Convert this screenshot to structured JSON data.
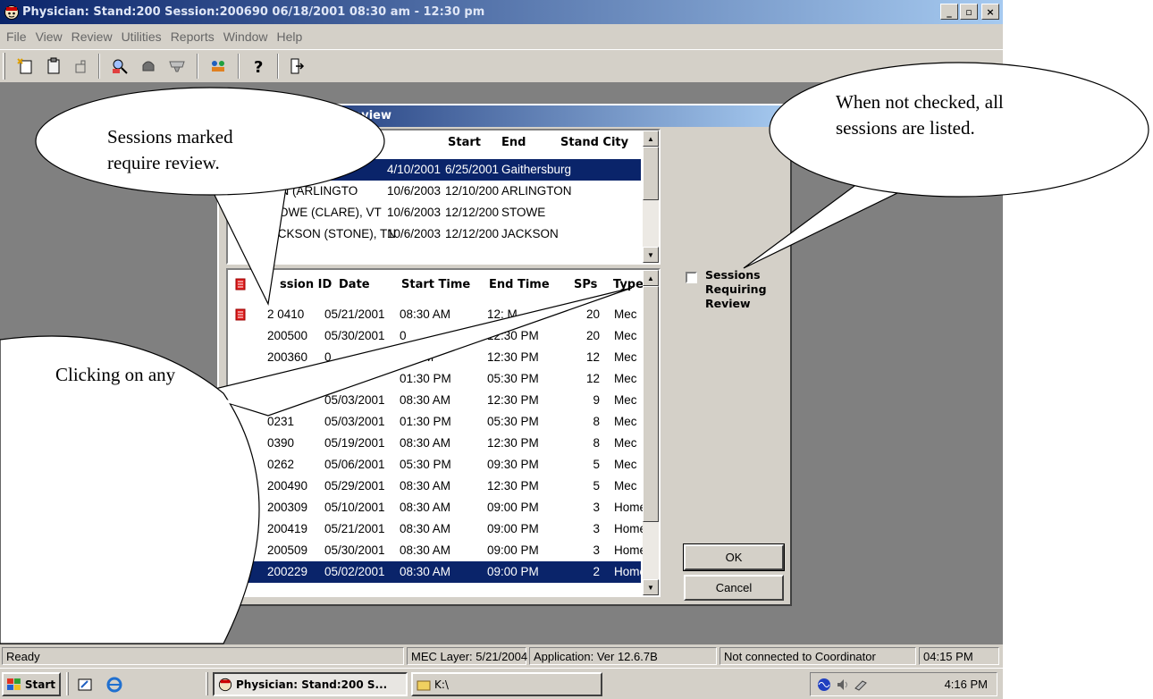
{
  "window": {
    "title": "Physician: Stand:200 Session:200690 06/18/2001 08:30 am - 12:30 pm",
    "min_glyph": "_",
    "max_glyph": "▫",
    "close_glyph": "×"
  },
  "menu": [
    "File",
    "View",
    "Review",
    "Utilities",
    "Reports",
    "Window",
    "Help"
  ],
  "toolbar_icons": [
    "new-icon",
    "clipboard-icon",
    "open-icon",
    "find-icon",
    "stop-icon",
    "filter-icon",
    "group-icon",
    "help-icon",
    "exit-icon"
  ],
  "dialog": {
    "title_visible": "iring Review",
    "stand_headers": {
      "start": "Start",
      "end": "End",
      "city": "Stand City"
    },
    "stands": [
      {
        "name": "",
        "start": "4/10/2001",
        "end": "6/25/2001",
        "city": "Gaithersburg",
        "selected": true
      },
      {
        "name": "TON (ARLINGTO",
        "start": "10/6/2003",
        "end": "12/10/200",
        "city": "ARLINGTON",
        "selected": false
      },
      {
        "name": "STOWE (CLARE), VT",
        "start": "10/6/2003",
        "end": "12/12/200",
        "city": "STOWE",
        "selected": false
      },
      {
        "name": "JACKSON (STONE), TN",
        "start": "10/6/2003",
        "end": "12/12/200",
        "city": "JACKSON",
        "selected": false
      }
    ],
    "session_headers": {
      "id": "ssion ID",
      "date": "Date",
      "start": "Start Time",
      "end": "End Time",
      "sps": "SPs",
      "type": "Type"
    },
    "sessions": [
      {
        "flag": true,
        "id": "2 0410",
        "date": "05/21/2001",
        "start": "08:30 AM",
        "end": "12:  M",
        "sps": "20",
        "type": "Mec",
        "selected": false
      },
      {
        "flag": false,
        "id": "200500",
        "date": "05/30/2001",
        "start": "0",
        "end": "12:30 PM",
        "sps": "20",
        "type": "Mec",
        "selected": false
      },
      {
        "flag": false,
        "id": "200360",
        "date": "0",
        "start": "30 AM",
        "end": "12:30 PM",
        "sps": "12",
        "type": "Mec",
        "selected": false
      },
      {
        "flag": false,
        "id": "",
        "date": "2001",
        "start": "01:30 PM",
        "end": "05:30 PM",
        "sps": "12",
        "type": "Mec",
        "selected": false
      },
      {
        "flag": false,
        "id": "",
        "date": "05/03/2001",
        "start": "08:30 AM",
        "end": "12:30 PM",
        "sps": "9",
        "type": "Mec",
        "selected": false
      },
      {
        "flag": false,
        "id": "0231",
        "date": "05/03/2001",
        "start": "01:30 PM",
        "end": "05:30 PM",
        "sps": "8",
        "type": "Mec",
        "selected": false
      },
      {
        "flag": false,
        "id": "0390",
        "date": "05/19/2001",
        "start": "08:30 AM",
        "end": "12:30 PM",
        "sps": "8",
        "type": "Mec",
        "selected": false
      },
      {
        "flag": false,
        "id": "0262",
        "date": "05/06/2001",
        "start": "05:30 PM",
        "end": "09:30 PM",
        "sps": "5",
        "type": "Mec",
        "selected": false
      },
      {
        "flag": false,
        "id": "200490",
        "date": "05/29/2001",
        "start": "08:30 AM",
        "end": "12:30 PM",
        "sps": "5",
        "type": "Mec",
        "selected": false
      },
      {
        "flag": false,
        "id": "200309",
        "date": "05/10/2001",
        "start": "08:30 AM",
        "end": "09:00 PM",
        "sps": "3",
        "type": "Home",
        "selected": false
      },
      {
        "flag": false,
        "id": "200419",
        "date": "05/21/2001",
        "start": "08:30 AM",
        "end": "09:00 PM",
        "sps": "3",
        "type": "Home",
        "selected": false
      },
      {
        "flag": false,
        "id": "200509",
        "date": "05/30/2001",
        "start": "08:30 AM",
        "end": "09:00 PM",
        "sps": "3",
        "type": "Home",
        "selected": false
      },
      {
        "flag": true,
        "id": "200229",
        "date": "05/02/2001",
        "start": "08:30 AM",
        "end": "09:00 PM",
        "sps": "2",
        "type": "Home",
        "selected": true
      }
    ],
    "checkbox_label": "Sessions Requiring Review",
    "checkbox_checked": false,
    "ok_label": "OK",
    "cancel_label": "Cancel"
  },
  "callouts": {
    "sessions_marked": "Sessions marked require review.",
    "not_checked": "When not checked, all sessions are listed.",
    "clicking": "Clicking on any"
  },
  "status": {
    "ready": "Ready",
    "mec_layer": "MEC Layer: 5/21/2004",
    "application": "Application: Ver 12.6.7B",
    "connection": "Not connected to Coordinator",
    "time": "04:15 PM"
  },
  "taskbar": {
    "start": "Start",
    "task1": "Physician: Stand:200 S...",
    "task2": "K:\\",
    "clock": "4:16 PM"
  },
  "colors": {
    "title_blue": "#0a246a",
    "selection": "#0a246a",
    "face": "#d4d0c8",
    "workspace": "#808080"
  }
}
